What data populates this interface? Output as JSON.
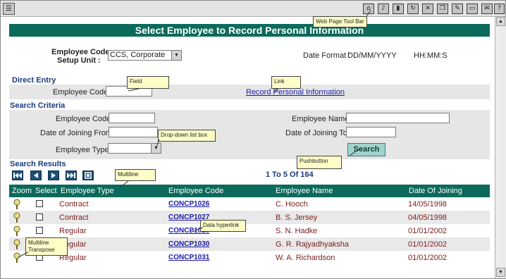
{
  "window": {
    "corner_icon": "app-icon",
    "toolbar_icons": [
      "home-icon",
      "help-icon",
      "print-icon",
      "refresh-icon",
      "close-icon",
      "copy-icon",
      "edit-icon",
      "document-icon",
      "mail-icon",
      "question-icon"
    ]
  },
  "page": {
    "title": "Select Employee to Record Personal Information",
    "employee_code_setup_unit_label_1": "Employee Code",
    "employee_code_setup_unit_label_2": "Setup Unit :",
    "setup_unit_value": "CCS, Corporate",
    "date_format_label": "Date Format :",
    "date_format_value": "DD/MM/YYYY",
    "time_format_value": "HH:MM:S"
  },
  "direct_entry": {
    "heading": "Direct Entry",
    "employee_code_label": "Employee Code :",
    "employee_code_value": "",
    "record_link": "Record Personal Information"
  },
  "search_criteria": {
    "heading": "Search Criteria",
    "employee_code_label": "Employee Code :",
    "employee_name_label": "Employee Name :",
    "doj_from_label": "Date of Joining From :",
    "doj_to_label": "Date of Joining To :",
    "employee_type_label": "Employee Type :",
    "employee_type_value": "",
    "search_button": "Search"
  },
  "results": {
    "heading": "Search Results",
    "pager": "1 To 5 Of 164",
    "columns": [
      "Zoom",
      "Select",
      "Employee Type",
      "Employee Code",
      "Employee Name",
      "Date Of Joining"
    ],
    "rows": [
      {
        "type": "Contract",
        "code": "CONCP1026",
        "name": "C. Hooch",
        "doj": "14/05/1998"
      },
      {
        "type": "Contract",
        "code": "CONCP1027",
        "name": "B. S. Jersey",
        "doj": "04/05/1998"
      },
      {
        "type": "Regular",
        "code": "CONCP1028",
        "name": "S. N. Hadke",
        "doj": "01/01/2002"
      },
      {
        "type": "Regular",
        "code": "CONCP1030",
        "name": "G. R. Rajyadhyaksha",
        "doj": "01/01/2002"
      },
      {
        "type": "Regular",
        "code": "CONCP1031",
        "name": "W. A. Richardson",
        "doj": "01/01/2002"
      }
    ]
  },
  "callouts": {
    "toolbar": "Web Page Tool Bar",
    "field": "Field",
    "link": "Link",
    "dropdown": "Drop-down list box",
    "pushbutton": "Pushbutton",
    "multiline": "Multiline",
    "data_hyperlink": "Data hyperlink",
    "multiline_transpose_1": "Multiline",
    "multiline_transpose_2": "Transpose"
  }
}
